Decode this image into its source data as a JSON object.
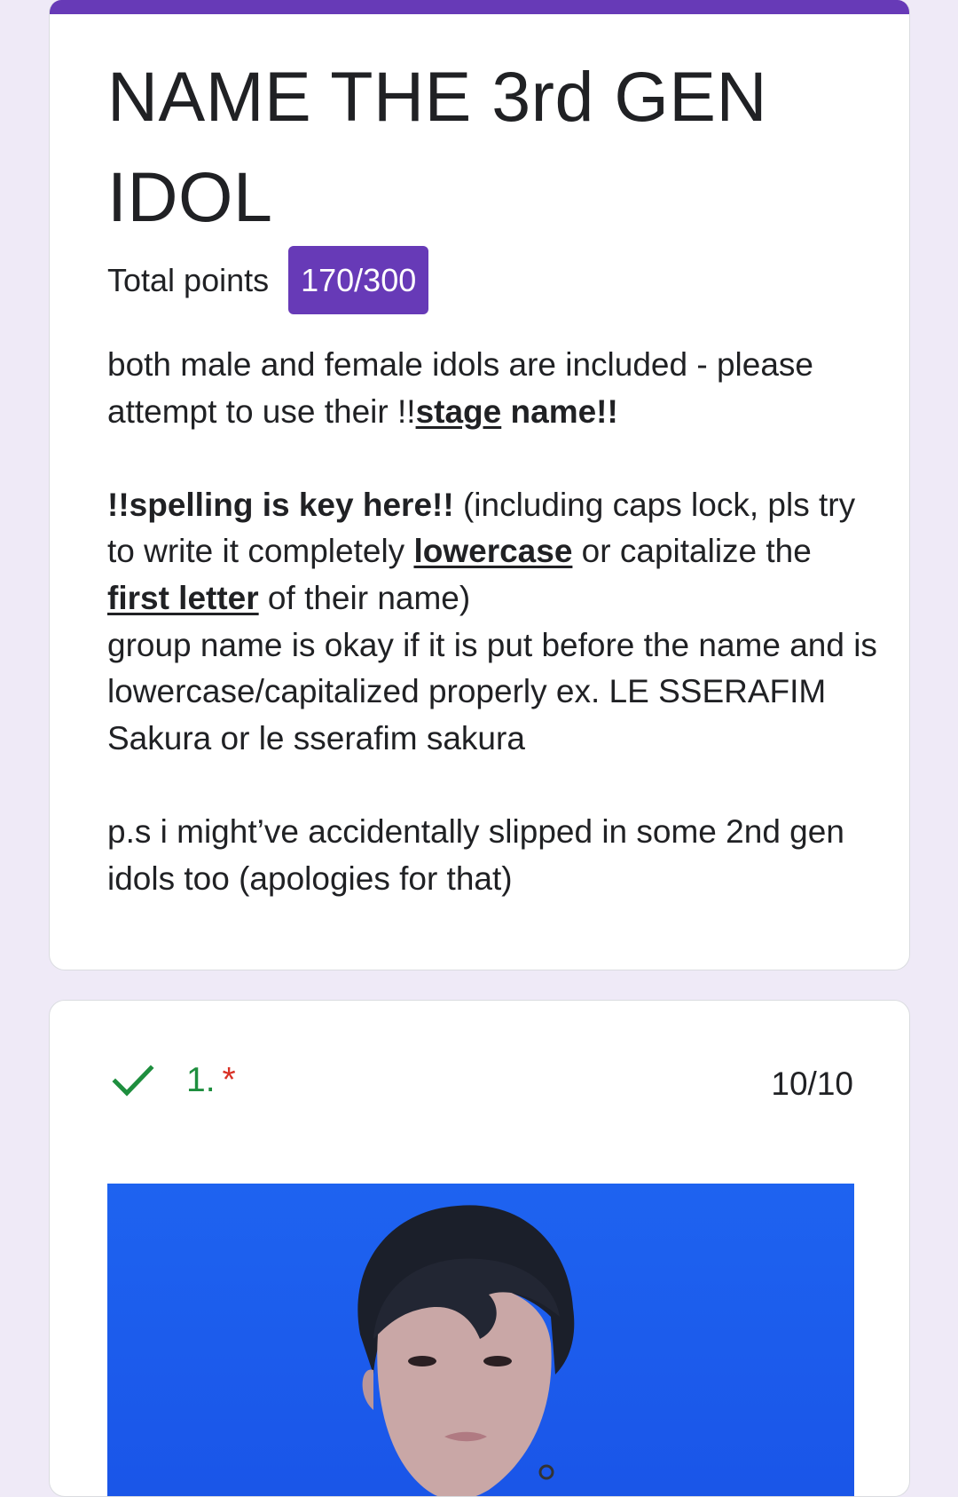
{
  "header": {
    "title": "NAME THE 3rd GEN IDOL",
    "total_points_label": "Total points",
    "total_points_value": "170/300",
    "accent_color": "#673ab7"
  },
  "description": {
    "p1_a": "both male and female idols are included - please attempt to use their ",
    "p1_b": "!!",
    "p1_c": "stage",
    "p1_d": " name!!",
    "p2_a": "!!spelling is key here!!",
    "p2_b": " (including caps lock, pls try to write it completely ",
    "p2_c": "lowercase",
    "p2_d": " or capitalize the ",
    "p2_e": "first letter",
    "p2_f": " of their name)",
    "p3": "group name is okay if it is put before the name and is lowercase/capitalized properly ex. LE SSERAFIM Sakura or le sserafim sakura",
    "p4": "p.s i might’ve accidentally slipped in some 2nd gen idols too (apologies for that)"
  },
  "question": {
    "number": "1.",
    "required_marker": "*",
    "score": "10/10",
    "status_icon": "check-icon",
    "correct_color": "#1e8e3e",
    "image_background_color": "#1a55e8"
  }
}
